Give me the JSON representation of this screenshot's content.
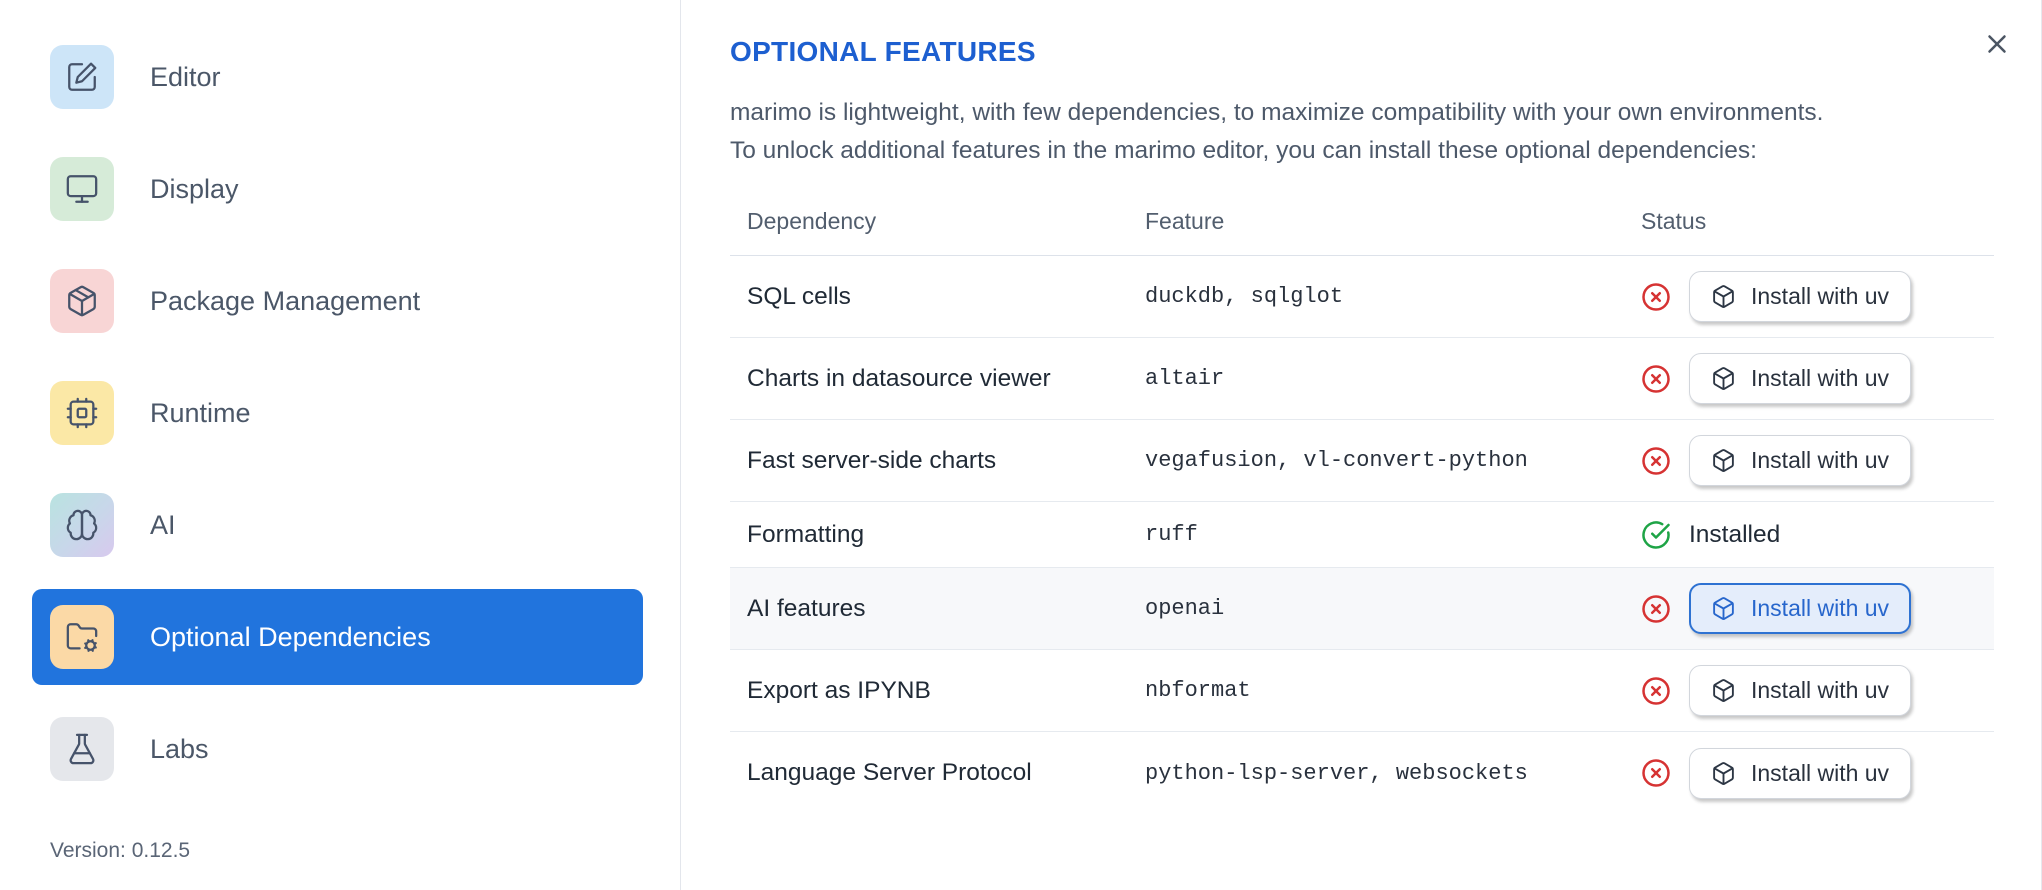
{
  "colors": {
    "sidebar_selected_blue": "#2174dd",
    "heading_blue": "#1d5fd0",
    "status_error_red": "#d63333",
    "status_success_green": "#1ea446",
    "focused_button_blue": "#2766cc"
  },
  "sidebar": {
    "items": [
      {
        "label": "Editor",
        "icon": "edit-icon",
        "selected": false
      },
      {
        "label": "Display",
        "icon": "monitor-icon",
        "selected": false
      },
      {
        "label": "Package Management",
        "icon": "package-icon",
        "selected": false
      },
      {
        "label": "Runtime",
        "icon": "cpu-icon",
        "selected": false
      },
      {
        "label": "AI",
        "icon": "brain-icon",
        "selected": false
      },
      {
        "label": "Optional Dependencies",
        "icon": "folder-cog-icon",
        "selected": true
      },
      {
        "label": "Labs",
        "icon": "flask-icon",
        "selected": false
      }
    ],
    "version": "Version: 0.12.5"
  },
  "panel": {
    "title": "OPTIONAL FEATURES",
    "description_lines": [
      "marimo is lightweight, with few dependencies, to maximize compatibility with your own environments.",
      "To unlock additional features in the marimo editor, you can install these optional dependencies:"
    ],
    "table": {
      "columns": [
        "Dependency",
        "Feature",
        "Status"
      ],
      "rows": [
        {
          "dependency": "SQL cells",
          "feature": "duckdb, sqlglot",
          "status": "not-installed",
          "action": "Install with uv"
        },
        {
          "dependency": "Charts in datasource viewer",
          "feature": "altair",
          "status": "not-installed",
          "action": "Install with uv"
        },
        {
          "dependency": "Fast server-side charts",
          "feature": "vegafusion, vl-convert-python",
          "status": "not-installed",
          "action": "Install with uv"
        },
        {
          "dependency": "Formatting",
          "feature": "ruff",
          "status": "installed",
          "status_label": "Installed"
        },
        {
          "dependency": "AI features",
          "feature": "openai",
          "status": "not-installed",
          "action": "Install with uv",
          "focused": true
        },
        {
          "dependency": "Export as IPYNB",
          "feature": "nbformat",
          "status": "not-installed",
          "action": "Install with uv"
        },
        {
          "dependency": "Language Server Protocol",
          "feature": "python-lsp-server, websockets",
          "status": "not-installed",
          "action": "Install with uv"
        }
      ]
    }
  }
}
